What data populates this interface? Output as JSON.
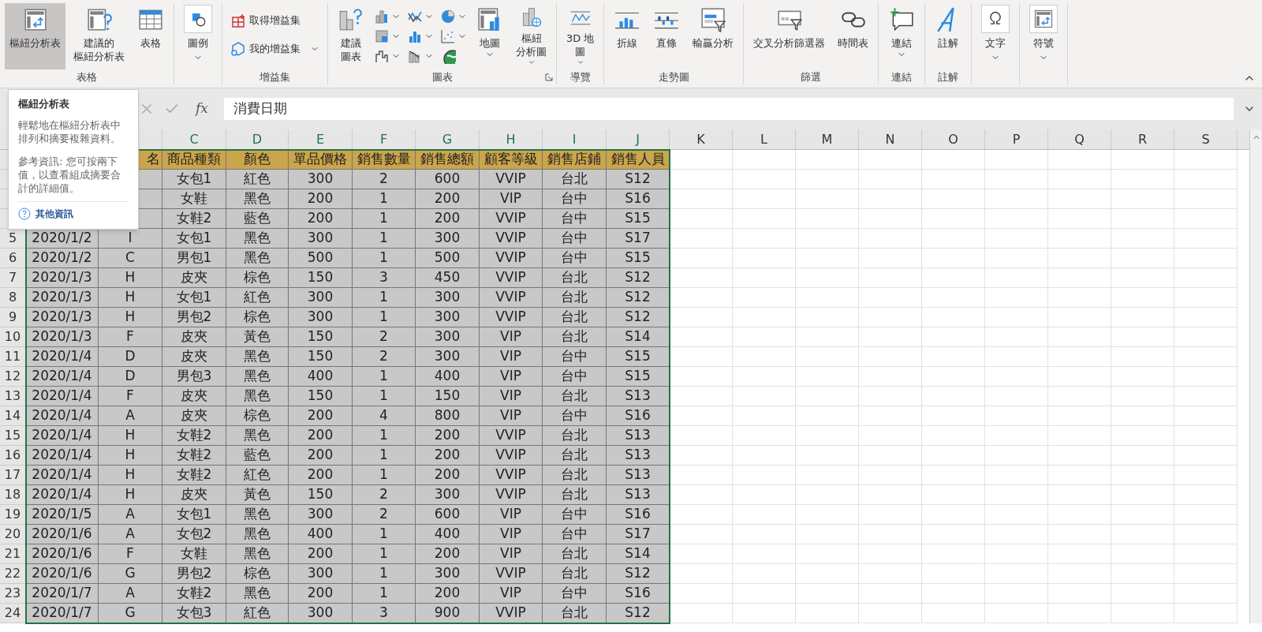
{
  "ribbon": {
    "groups": [
      {
        "label": "表格",
        "buttons": [
          {
            "kind": "large",
            "label": "樞紐分析表",
            "selected": true,
            "has_menu": false
          },
          {
            "kind": "large",
            "label": [
              "建議的",
              "樞紐分析表"
            ],
            "selected": false,
            "has_menu": false
          },
          {
            "kind": "large",
            "label": "表格",
            "selected": false,
            "has_menu": false
          }
        ]
      },
      {
        "buttons": [
          {
            "kind": "boxed",
            "label": "圖例",
            "selected": false,
            "has_menu": true
          }
        ]
      },
      {
        "label": "增益集",
        "buttons": [
          {
            "kind": "small",
            "label": "取得增益集",
            "selected": false,
            "has_menu": false
          },
          {
            "kind": "small",
            "label": "我的增益集",
            "selected": false,
            "has_menu": true
          }
        ]
      },
      {
        "label": "圖表",
        "launcher": true,
        "buttons": [
          {
            "kind": "large",
            "label": [
              "建議",
              "圖表"
            ],
            "selected": false,
            "has_menu": false
          },
          {
            "kind": "icon",
            "selected": false,
            "has_menu": true
          },
          {
            "kind": "icon",
            "selected": false,
            "has_menu": true
          },
          {
            "kind": "icon",
            "selected": false,
            "has_menu": true
          },
          {
            "kind": "icon",
            "selected": false,
            "has_menu": true
          },
          {
            "kind": "icon",
            "selected": false,
            "has_menu": true
          },
          {
            "kind": "icon",
            "selected": false,
            "has_menu": true
          },
          {
            "kind": "icon",
            "selected": false,
            "has_menu": true
          },
          {
            "kind": "icon",
            "selected": false,
            "has_menu": true
          },
          {
            "kind": "icon",
            "selected": false,
            "has_menu": false
          },
          {
            "kind": "large",
            "label": "地圖",
            "selected": false,
            "has_menu": true
          },
          {
            "kind": "large",
            "label": [
              "樞紐",
              "分析圖"
            ],
            "selected": false,
            "has_menu": true
          }
        ]
      },
      {
        "label": "導覽",
        "buttons": [
          {
            "kind": "large",
            "label": [
              "3D 地",
              "圖"
            ],
            "selected": false,
            "has_menu": true
          }
        ]
      },
      {
        "label": "走勢圖",
        "buttons": [
          {
            "kind": "large",
            "label": "折線",
            "selected": false,
            "has_menu": false
          },
          {
            "kind": "large",
            "label": "直條",
            "selected": false,
            "has_menu": false
          },
          {
            "kind": "large",
            "label": "輸贏分析",
            "selected": false,
            "has_menu": false
          }
        ]
      },
      {
        "label": "篩選",
        "buttons": [
          {
            "kind": "large",
            "label": "交叉分析篩選器",
            "selected": false,
            "has_menu": false
          },
          {
            "kind": "large",
            "label": "時間表",
            "selected": false,
            "has_menu": false
          }
        ]
      },
      {
        "label": "連結",
        "buttons": [
          {
            "kind": "large",
            "label": "連結",
            "selected": false,
            "has_menu": true
          }
        ]
      },
      {
        "label": "註解",
        "buttons": [
          {
            "kind": "large",
            "label": "註解",
            "selected": false,
            "has_menu": false
          }
        ]
      },
      {
        "buttons": [
          {
            "kind": "boxed",
            "label": "文字",
            "selected": false,
            "has_menu": true
          }
        ]
      },
      {
        "buttons": [
          {
            "kind": "boxed",
            "label": "符號",
            "selected": false,
            "has_menu": true
          }
        ]
      }
    ]
  },
  "formula_bar": {
    "function_label": "fx",
    "value": "消費日期"
  },
  "tooltip": {
    "title": "樞紐分析表",
    "description": "輕鬆地在樞紐分析表中排列和摘要複雜資料。",
    "note": "參考資訊: 您可按兩下值，以查看組成摘要合計的詳細值。",
    "link": "其他資訊"
  },
  "sheet": {
    "columns": [
      "",
      "",
      "C",
      "D",
      "E",
      "F",
      "G",
      "H",
      "I",
      "J",
      "K",
      "L",
      "M",
      "N",
      "O",
      "P",
      "Q",
      "R",
      "S"
    ],
    "rows": [
      {
        "kind": "header",
        "cells": [
          null,
          "名",
          "商品種類",
          "顏色",
          "單品價格",
          "銷售數量",
          "銷售總額",
          "顧客等級",
          "銷售店鋪",
          "銷售人員"
        ]
      },
      {
        "kind": "data",
        "cells": [
          null,
          null,
          "女包1",
          "紅色",
          "300",
          "2",
          "600",
          "VVIP",
          "台北",
          "S12"
        ]
      },
      {
        "kind": "data",
        "cells": [
          null,
          null,
          "女鞋",
          "黑色",
          "200",
          "1",
          "200",
          "VIP",
          "台中",
          "S16"
        ]
      },
      {
        "kind": "data",
        "cells": [
          null,
          null,
          "女鞋2",
          "藍色",
          "200",
          "1",
          "200",
          "VVIP",
          "台中",
          "S15"
        ]
      },
      {
        "kind": "data",
        "number": "5",
        "cells": [
          "2020/1/2",
          "I",
          "女包1",
          "黑色",
          "300",
          "1",
          "300",
          "VVIP",
          "台中",
          "S17"
        ]
      },
      {
        "kind": "data",
        "number": "6",
        "cells": [
          "2020/1/2",
          "C",
          "男包1",
          "黑色",
          "500",
          "1",
          "500",
          "VVIP",
          "台中",
          "S15"
        ]
      },
      {
        "kind": "data",
        "number": "7",
        "cells": [
          "2020/1/3",
          "H",
          "皮夾",
          "棕色",
          "150",
          "3",
          "450",
          "VVIP",
          "台北",
          "S12"
        ]
      },
      {
        "kind": "data",
        "number": "8",
        "cells": [
          "2020/1/3",
          "H",
          "女包1",
          "紅色",
          "300",
          "1",
          "300",
          "VVIP",
          "台北",
          "S12"
        ]
      },
      {
        "kind": "data",
        "number": "9",
        "cells": [
          "2020/1/3",
          "H",
          "男包2",
          "棕色",
          "300",
          "1",
          "300",
          "VVIP",
          "台北",
          "S12"
        ]
      },
      {
        "kind": "data",
        "number": "10",
        "cells": [
          "2020/1/3",
          "F",
          "皮夾",
          "黃色",
          "150",
          "2",
          "300",
          "VIP",
          "台北",
          "S14"
        ]
      },
      {
        "kind": "data",
        "number": "11",
        "cells": [
          "2020/1/4",
          "D",
          "皮夾",
          "黑色",
          "150",
          "2",
          "300",
          "VIP",
          "台中",
          "S15"
        ]
      },
      {
        "kind": "data",
        "number": "12",
        "cells": [
          "2020/1/4",
          "D",
          "男包3",
          "黑色",
          "400",
          "1",
          "400",
          "VIP",
          "台中",
          "S15"
        ]
      },
      {
        "kind": "data",
        "number": "13",
        "cells": [
          "2020/1/4",
          "F",
          "皮夾",
          "黑色",
          "150",
          "1",
          "150",
          "VIP",
          "台北",
          "S13"
        ]
      },
      {
        "kind": "data",
        "number": "14",
        "cells": [
          "2020/1/4",
          "A",
          "皮夾",
          "棕色",
          "200",
          "4",
          "800",
          "VIP",
          "台中",
          "S16"
        ]
      },
      {
        "kind": "data",
        "number": "15",
        "cells": [
          "2020/1/4",
          "H",
          "女鞋2",
          "黑色",
          "200",
          "1",
          "200",
          "VVIP",
          "台北",
          "S13"
        ]
      },
      {
        "kind": "data",
        "number": "16",
        "cells": [
          "2020/1/4",
          "H",
          "女鞋2",
          "藍色",
          "200",
          "1",
          "200",
          "VVIP",
          "台北",
          "S13"
        ]
      },
      {
        "kind": "data",
        "number": "17",
        "cells": [
          "2020/1/4",
          "H",
          "女鞋2",
          "紅色",
          "200",
          "1",
          "200",
          "VVIP",
          "台北",
          "S13"
        ]
      },
      {
        "kind": "data",
        "number": "18",
        "cells": [
          "2020/1/4",
          "H",
          "皮夾",
          "黃色",
          "150",
          "2",
          "300",
          "VVIP",
          "台北",
          "S13"
        ]
      },
      {
        "kind": "data",
        "number": "19",
        "cells": [
          "2020/1/5",
          "A",
          "女包1",
          "黑色",
          "300",
          "2",
          "600",
          "VIP",
          "台中",
          "S16"
        ]
      },
      {
        "kind": "data",
        "number": "20",
        "cells": [
          "2020/1/6",
          "A",
          "女包2",
          "黑色",
          "400",
          "1",
          "400",
          "VIP",
          "台中",
          "S17"
        ]
      },
      {
        "kind": "data",
        "number": "21",
        "cells": [
          "2020/1/6",
          "F",
          "女鞋",
          "黑色",
          "200",
          "1",
          "200",
          "VIP",
          "台北",
          "S14"
        ]
      },
      {
        "kind": "data",
        "number": "22",
        "cells": [
          "2020/1/6",
          "G",
          "男包2",
          "棕色",
          "300",
          "1",
          "300",
          "VVIP",
          "台北",
          "S12"
        ]
      },
      {
        "kind": "data",
        "number": "23",
        "cells": [
          "2020/1/7",
          "A",
          "女鞋2",
          "黑色",
          "200",
          "1",
          "200",
          "VIP",
          "台中",
          "S16"
        ]
      },
      {
        "kind": "data",
        "number": "24",
        "cells": [
          "2020/1/7",
          "G",
          "女包3",
          "紅色",
          "300",
          "3",
          "900",
          "VVIP",
          "台北",
          "S12"
        ]
      }
    ]
  }
}
